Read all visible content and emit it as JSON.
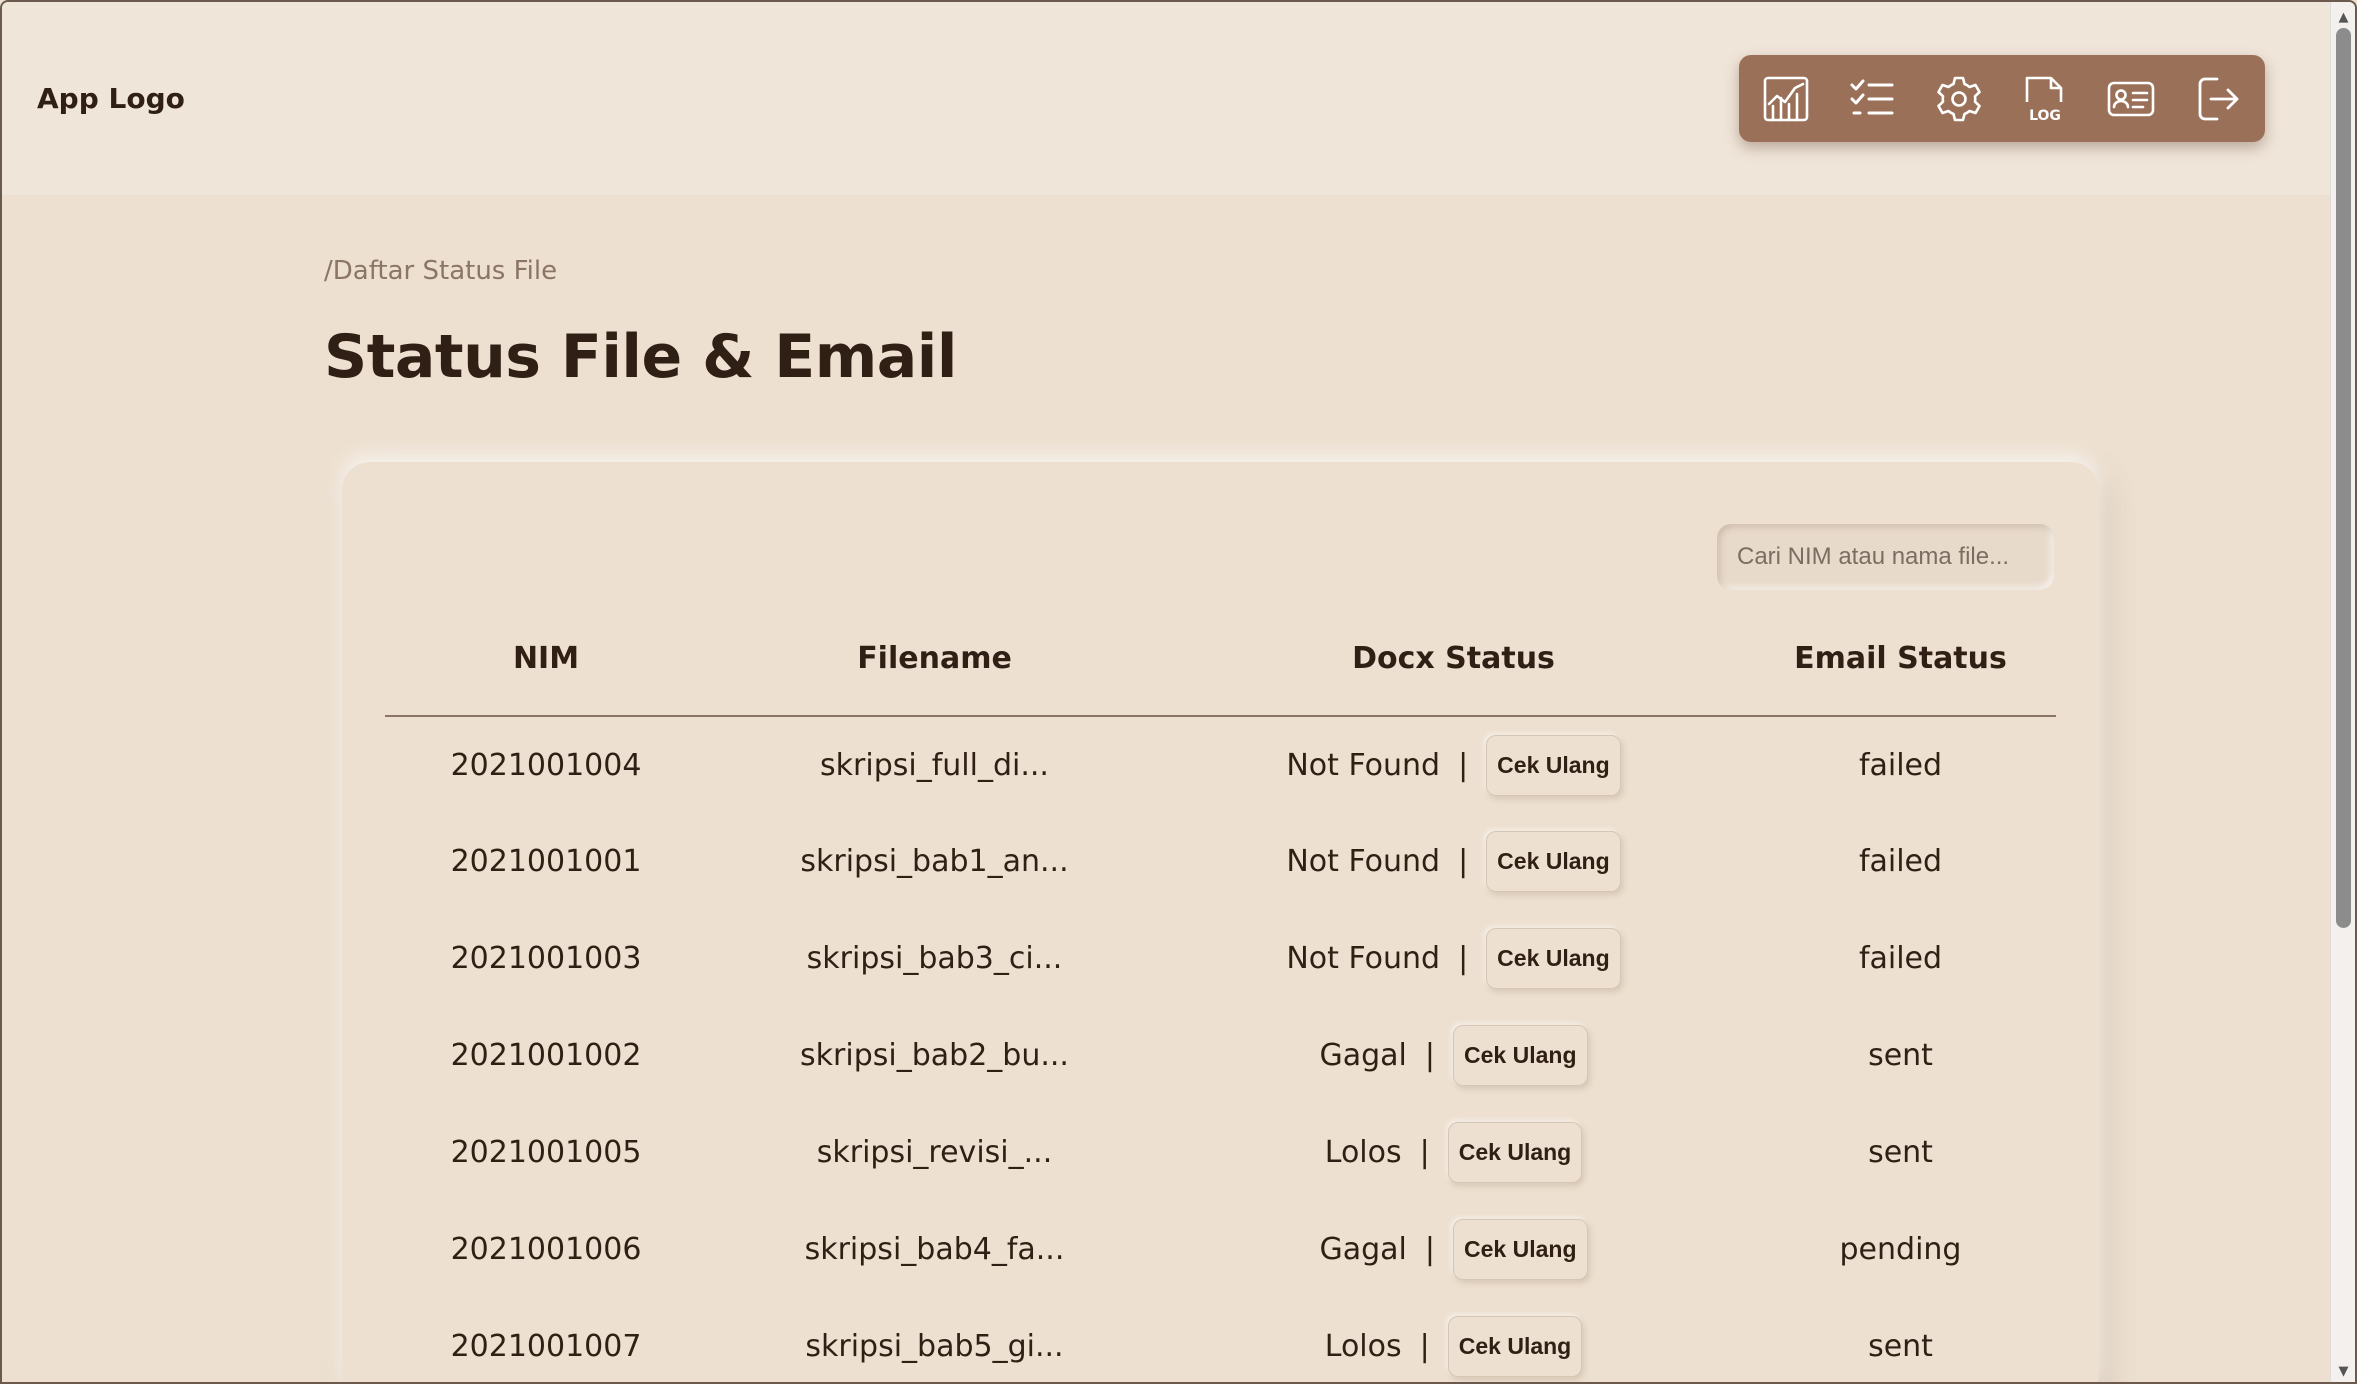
{
  "header": {
    "logo": "App Logo",
    "toolbar": [
      {
        "icon": "chart-icon",
        "label": "Dashboard"
      },
      {
        "icon": "checklist-icon",
        "label": "Checklist"
      },
      {
        "icon": "gear-icon",
        "label": "Settings"
      },
      {
        "icon": "log-file-icon",
        "label": "LOG"
      },
      {
        "icon": "id-card-icon",
        "label": "Profile"
      },
      {
        "icon": "logout-icon",
        "label": "Logout"
      }
    ]
  },
  "breadcrumb": "/Daftar Status File",
  "page_title": "Status File & Email",
  "search": {
    "placeholder": "Cari NIM atau nama file..."
  },
  "table": {
    "headers": {
      "nim": "NIM",
      "filename": "Filename",
      "docx_status": "Docx Status",
      "email_status": "Email Status"
    },
    "separator": "|",
    "action_label": "Cek Ulang",
    "rows": [
      {
        "nim": "2021001004",
        "filename": "skripsi_full_di...",
        "docx_status": "Not Found",
        "email_status": "failed"
      },
      {
        "nim": "2021001001",
        "filename": "skripsi_bab1_an...",
        "docx_status": "Not Found",
        "email_status": "failed"
      },
      {
        "nim": "2021001003",
        "filename": "skripsi_bab3_ci...",
        "docx_status": "Not Found",
        "email_status": "failed"
      },
      {
        "nim": "2021001002",
        "filename": "skripsi_bab2_bu...",
        "docx_status": "Gagal",
        "email_status": "sent"
      },
      {
        "nim": "2021001005",
        "filename": "skripsi_revisi_...",
        "docx_status": "Lolos",
        "email_status": "sent"
      },
      {
        "nim": "2021001006",
        "filename": "skripsi_bab4_fa...",
        "docx_status": "Gagal",
        "email_status": "pending"
      },
      {
        "nim": "2021001007",
        "filename": "skripsi_bab5_gi...",
        "docx_status": "Lolos",
        "email_status": "sent"
      }
    ]
  },
  "colors": {
    "background": "#ede0d0",
    "header_bg": "#f0e5d9",
    "toolbar_bg": "#9a7158",
    "text_primary": "#2f1f14",
    "text_muted": "#8b7565"
  }
}
